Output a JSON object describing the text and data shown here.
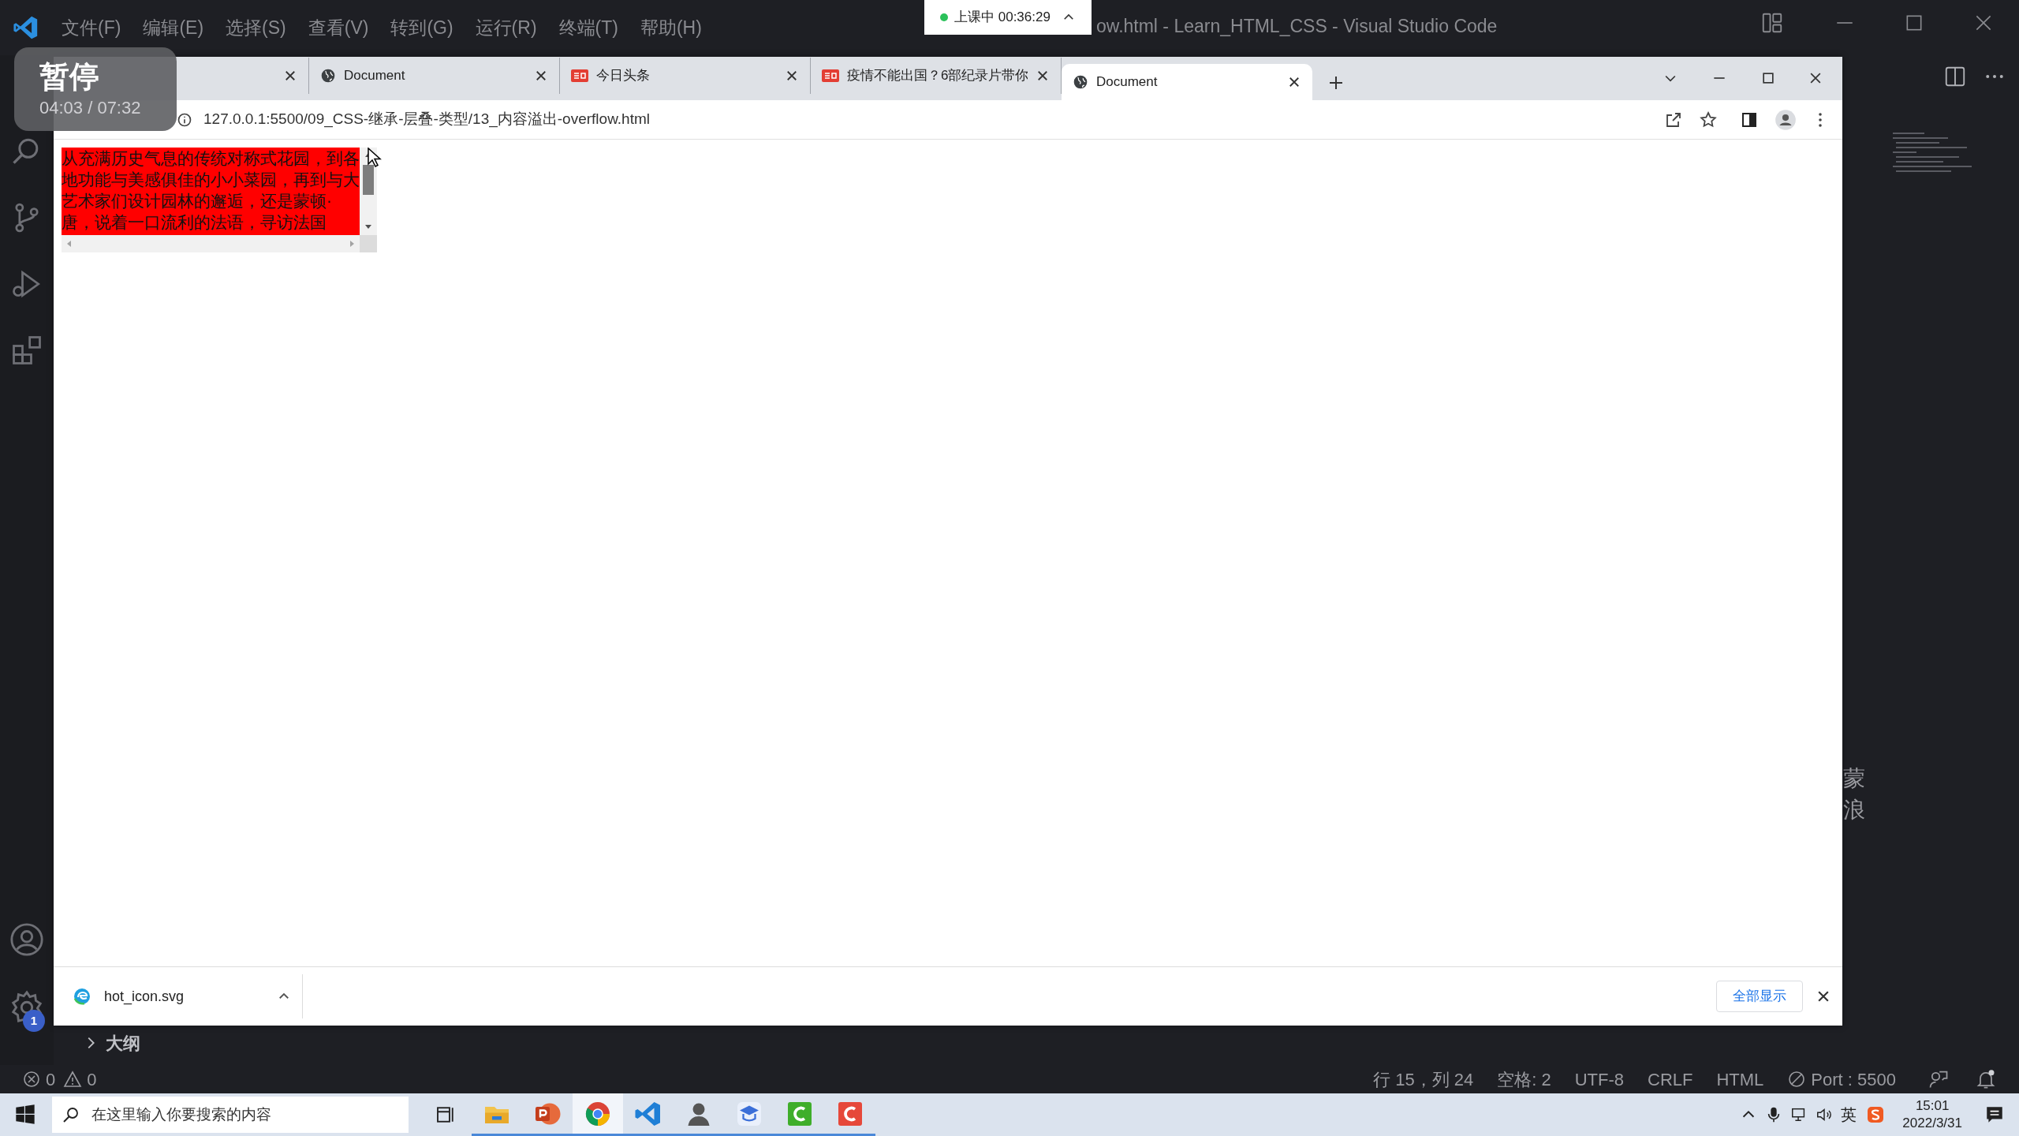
{
  "title_bar": {
    "menu": [
      "文件(F)",
      "编辑(E)",
      "选择(S)",
      "查看(V)",
      "转到(G)",
      "运行(R)",
      "终端(T)",
      "帮助(H)"
    ],
    "title": "ow.html - Learn_HTML_CSS - Visual Studio Code"
  },
  "class_timer": {
    "label": "上课中 00:36:29"
  },
  "video_overlay": {
    "state": "暂停",
    "time": "04:03 / 07:32"
  },
  "browser": {
    "tabs": [
      {
        "kind": "hidden",
        "selected": false
      },
      {
        "kind": "globe",
        "label": "Document",
        "selected": false
      },
      {
        "kind": "news",
        "label": "今日头条",
        "selected": false
      },
      {
        "kind": "news",
        "label": "疫情不能出国？6部纪录片带你",
        "selected": false
      },
      {
        "kind": "globe",
        "label": "Document",
        "selected": true
      }
    ],
    "address_bar": {
      "url": "127.0.0.1:5500/09_CSS-继承-层叠-类型/13_内容溢出-overflow.html"
    },
    "page": {
      "overflow_box": {
        "text": "从充满历史气息的传统对称式花园，到各地功能与美感俱佳的小小菜园，再到与大艺术家们设计园林的邂逅，还是蒙顿·唐，说着一口流利的法语，寻访法国"
      }
    },
    "download_bar": {
      "items": [
        {
          "file": "hot_icon.svg"
        }
      ],
      "show_all": "全部显示"
    }
  },
  "editor_fragments": [
    "蒙",
    "浪"
  ],
  "side_panel": {
    "outline": {
      "label": "大纲",
      "expanded": false
    }
  },
  "activity_bar": {
    "settings_badge": "1"
  },
  "status_bar": {
    "errors": "0",
    "warnings": "0",
    "items": [
      {
        "kind": "plain",
        "text": "行 15，列 24"
      },
      {
        "kind": "plain",
        "text": "空格: 2"
      },
      {
        "kind": "plain",
        "text": "UTF-8"
      },
      {
        "kind": "plain",
        "text": "CRLF"
      },
      {
        "kind": "plain",
        "text": "HTML"
      },
      {
        "kind": "port",
        "text": "Port : 5500"
      }
    ]
  },
  "taskbar": {
    "search_placeholder": "在这里输入你要搜索的内容",
    "apps": [
      {
        "kind": "explorer",
        "active": false
      },
      {
        "kind": "powerpoint",
        "active": false
      },
      {
        "kind": "chrome",
        "active": true
      },
      {
        "kind": "vscode",
        "active": false
      },
      {
        "kind": "person",
        "active": false
      },
      {
        "kind": "study",
        "active": false
      },
      {
        "kind": "green-c",
        "active": false
      },
      {
        "kind": "red-c",
        "active": false
      }
    ],
    "ime": "英",
    "time": "15:01",
    "date": "2022/3/31"
  }
}
